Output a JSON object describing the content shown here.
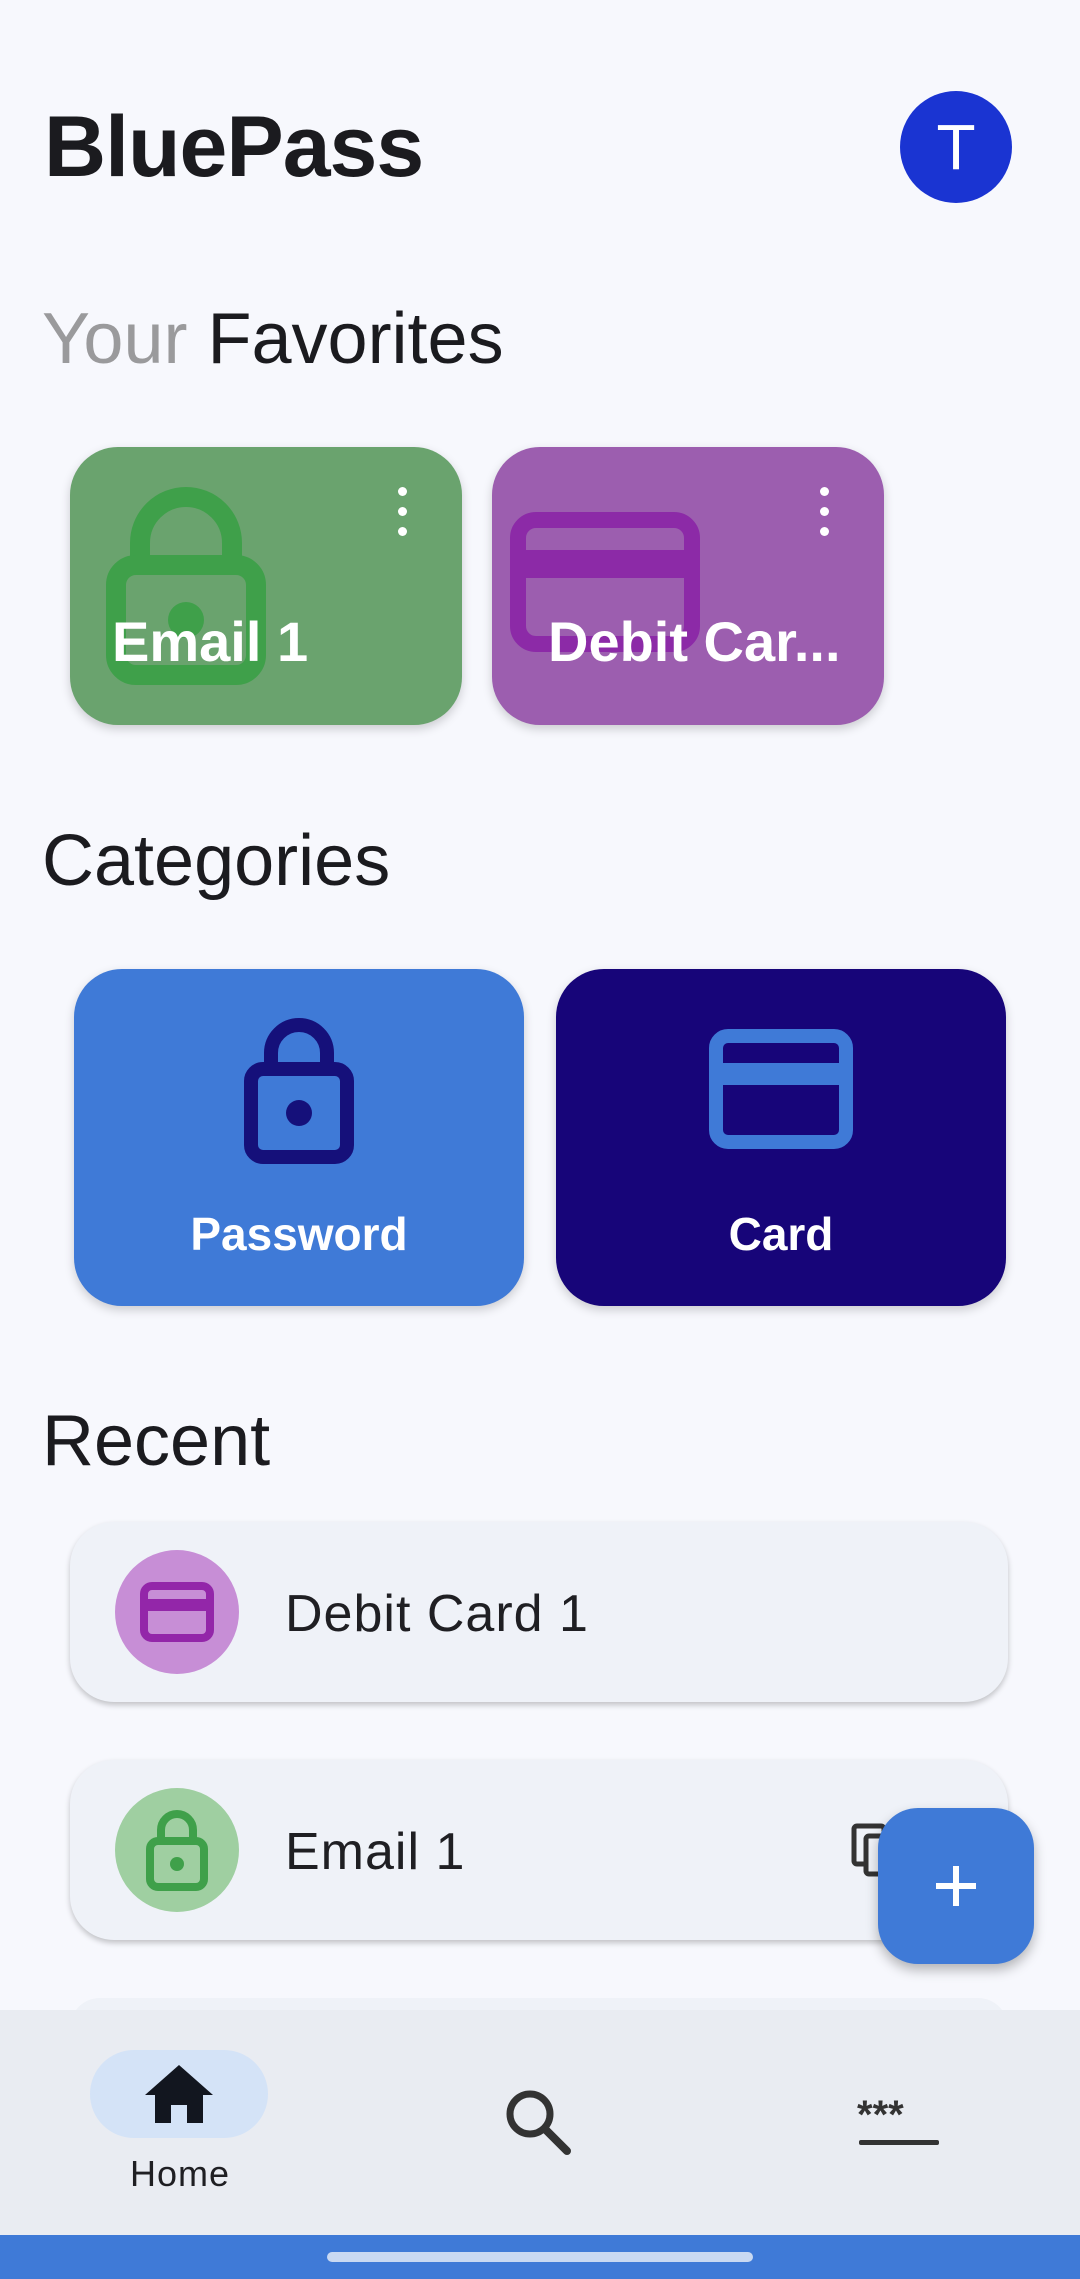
{
  "app": {
    "title": "BluePass",
    "avatar_letter": "T"
  },
  "favorites": {
    "title_muted": "Your",
    "title": "Favorites",
    "items": [
      {
        "label": "Email 1",
        "icon": "lock-icon",
        "color": "#6aa36e",
        "icon_color": "#3fa04a"
      },
      {
        "label": "Debit Car...",
        "icon": "credit-card-icon",
        "color": "#9c5eaf",
        "icon_color": "#8c2aa7"
      }
    ]
  },
  "categories": {
    "title": "Categories",
    "items": [
      {
        "label": "Password",
        "icon": "lock-icon",
        "color": "#3f7ad7",
        "icon_color": "#15107a"
      },
      {
        "label": "Card",
        "icon": "credit-card-icon",
        "color": "#170579",
        "icon_color": "#3f7ad7"
      }
    ]
  },
  "recent": {
    "title": "Recent",
    "items": [
      {
        "label": "Debit Card 1",
        "icon": "credit-card-icon",
        "circle_color": "#c78ed6",
        "icon_color": "#9326a9"
      },
      {
        "label": "Email 1",
        "icon": "lock-icon",
        "circle_color": "#9fcfa1",
        "icon_color": "#3fa04a"
      }
    ]
  },
  "nav": {
    "items": [
      {
        "label": "Home",
        "icon": "home-icon",
        "active": true
      },
      {
        "label": "",
        "icon": "search-icon",
        "active": false
      },
      {
        "label": "",
        "icon": "password-icon",
        "active": false
      }
    ]
  },
  "colors": {
    "accent": "#3f7ad7",
    "background": "#f7f8fd"
  }
}
